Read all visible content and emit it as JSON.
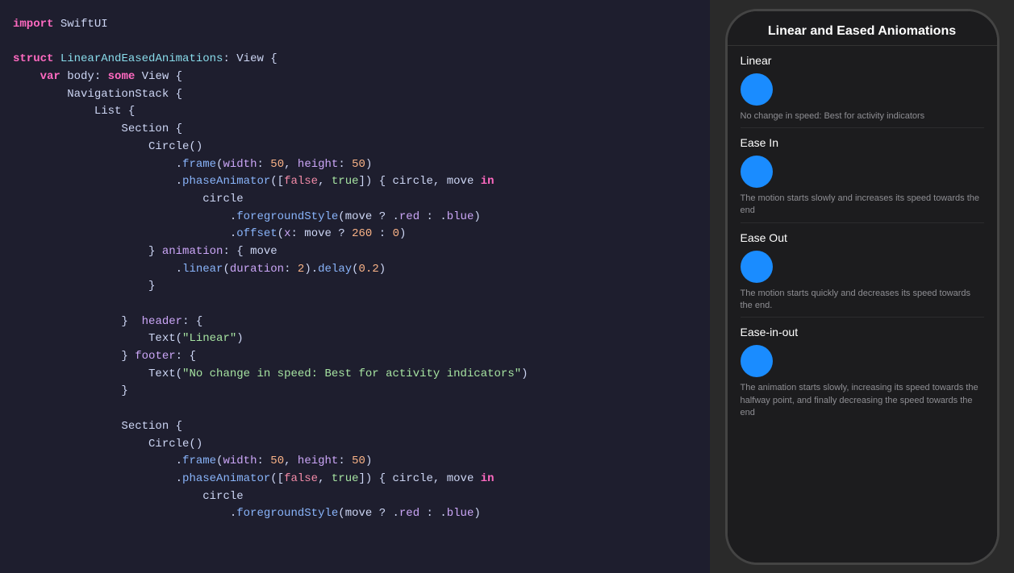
{
  "code_editor": {
    "lines": [
      {
        "tokens": [
          {
            "t": "kw-import",
            "v": "import"
          },
          {
            "t": "plain",
            "v": " SwiftUI"
          }
        ]
      },
      {
        "tokens": []
      },
      {
        "tokens": [
          {
            "t": "kw-struct",
            "v": "struct"
          },
          {
            "t": "plain",
            "v": " "
          },
          {
            "t": "type-name",
            "v": "LinearAndEasedAnimations"
          },
          {
            "t": "plain",
            "v": ": View {"
          }
        ]
      },
      {
        "tokens": [
          {
            "t": "plain",
            "v": "    "
          },
          {
            "t": "kw-var",
            "v": "var"
          },
          {
            "t": "plain",
            "v": " body: "
          },
          {
            "t": "kw-some",
            "v": "some"
          },
          {
            "t": "plain",
            "v": " View {"
          }
        ]
      },
      {
        "tokens": [
          {
            "t": "plain",
            "v": "        NavigationStack {"
          }
        ]
      },
      {
        "tokens": [
          {
            "t": "plain",
            "v": "            List {"
          }
        ]
      },
      {
        "tokens": [
          {
            "t": "plain",
            "v": "                Section {"
          }
        ]
      },
      {
        "tokens": [
          {
            "t": "plain",
            "v": "                    Circle()"
          }
        ]
      },
      {
        "tokens": [
          {
            "t": "plain",
            "v": "                        ."
          },
          {
            "t": "method",
            "v": "frame"
          },
          {
            "t": "plain",
            "v": "("
          },
          {
            "t": "prop",
            "v": "width"
          },
          {
            "t": "plain",
            "v": ": "
          },
          {
            "t": "num",
            "v": "50"
          },
          {
            "t": "plain",
            "v": ", "
          },
          {
            "t": "prop",
            "v": "height"
          },
          {
            "t": "plain",
            "v": ": "
          },
          {
            "t": "num",
            "v": "50"
          },
          {
            "t": "plain",
            "v": ")"
          }
        ]
      },
      {
        "tokens": [
          {
            "t": "plain",
            "v": "                        ."
          },
          {
            "t": "method",
            "v": "phaseAnimator"
          },
          {
            "t": "plain",
            "v": "(["
          },
          {
            "t": "bool-false",
            "v": "false"
          },
          {
            "t": "plain",
            "v": ", "
          },
          {
            "t": "bool-true",
            "v": "true"
          },
          {
            "t": "plain",
            "v": "]) { circle, "
          },
          {
            "t": "kw-move",
            "v": "move"
          },
          {
            "t": "plain",
            "v": " "
          },
          {
            "t": "kw-in",
            "v": "in"
          }
        ]
      },
      {
        "tokens": [
          {
            "t": "plain",
            "v": "                            circle"
          }
        ]
      },
      {
        "tokens": [
          {
            "t": "plain",
            "v": "                                ."
          },
          {
            "t": "method",
            "v": "foregroundStyle"
          },
          {
            "t": "plain",
            "v": "("
          },
          {
            "t": "kw-move",
            "v": "move"
          },
          {
            "t": "plain",
            "v": " ? ."
          },
          {
            "t": "prop",
            "v": "red"
          },
          {
            "t": "plain",
            "v": " : ."
          },
          {
            "t": "prop",
            "v": "blue"
          },
          {
            "t": "plain",
            "v": ")"
          }
        ]
      },
      {
        "tokens": [
          {
            "t": "plain",
            "v": "                                ."
          },
          {
            "t": "method",
            "v": "offset"
          },
          {
            "t": "plain",
            "v": "("
          },
          {
            "t": "prop",
            "v": "x"
          },
          {
            "t": "plain",
            "v": ": "
          },
          {
            "t": "kw-move",
            "v": "move"
          },
          {
            "t": "plain",
            "v": " ? "
          },
          {
            "t": "num",
            "v": "260"
          },
          {
            "t": "plain",
            "v": " : "
          },
          {
            "t": "num",
            "v": "0"
          },
          {
            "t": "plain",
            "v": ")"
          }
        ]
      },
      {
        "tokens": [
          {
            "t": "plain",
            "v": "                    } "
          },
          {
            "t": "prop",
            "v": "animation"
          },
          {
            "t": "plain",
            "v": ": { "
          },
          {
            "t": "kw-move",
            "v": "move"
          },
          {
            "t": "plain",
            "v": " "
          },
          {
            "t": "kw-in"
          }
        ]
      },
      {
        "tokens": [
          {
            "t": "plain",
            "v": "                        ."
          },
          {
            "t": "method",
            "v": "linear"
          },
          {
            "t": "plain",
            "v": "("
          },
          {
            "t": "prop",
            "v": "duration"
          },
          {
            "t": "plain",
            "v": ": "
          },
          {
            "t": "num",
            "v": "2"
          },
          {
            "t": "plain",
            "v": ")."
          },
          {
            "t": "method",
            "v": "delay"
          },
          {
            "t": "plain",
            "v": "("
          },
          {
            "t": "num",
            "v": "0.2"
          },
          {
            "t": "plain",
            "v": ")"
          }
        ]
      },
      {
        "tokens": [
          {
            "t": "plain",
            "v": "                    }"
          }
        ]
      },
      {
        "tokens": []
      },
      {
        "tokens": [
          {
            "t": "plain",
            "v": "                }  "
          },
          {
            "t": "prop",
            "v": "header"
          },
          {
            "t": "plain",
            "v": ": {"
          }
        ]
      },
      {
        "tokens": [
          {
            "t": "plain",
            "v": "                    Text("
          },
          {
            "t": "str",
            "v": "\"Linear\""
          },
          {
            "t": "plain",
            "v": ")"
          }
        ]
      },
      {
        "tokens": [
          {
            "t": "plain",
            "v": "                } "
          },
          {
            "t": "prop",
            "v": "footer"
          },
          {
            "t": "plain",
            "v": ": {"
          }
        ]
      },
      {
        "tokens": [
          {
            "t": "plain",
            "v": "                    Text("
          },
          {
            "t": "str",
            "v": "\"No change in speed: Best for activity indicators\""
          },
          {
            "t": "plain",
            "v": ")"
          }
        ]
      },
      {
        "tokens": [
          {
            "t": "plain",
            "v": "                }"
          }
        ]
      },
      {
        "tokens": []
      },
      {
        "tokens": [
          {
            "t": "plain",
            "v": "                Section {"
          }
        ]
      },
      {
        "tokens": [
          {
            "t": "plain",
            "v": "                    Circle()"
          }
        ]
      },
      {
        "tokens": [
          {
            "t": "plain",
            "v": "                        ."
          },
          {
            "t": "method",
            "v": "frame"
          },
          {
            "t": "plain",
            "v": "("
          },
          {
            "t": "prop",
            "v": "width"
          },
          {
            "t": "plain",
            "v": ": "
          },
          {
            "t": "num",
            "v": "50"
          },
          {
            "t": "plain",
            "v": ", "
          },
          {
            "t": "prop",
            "v": "height"
          },
          {
            "t": "plain",
            "v": ": "
          },
          {
            "t": "num",
            "v": "50"
          },
          {
            "t": "plain",
            "v": ")"
          }
        ]
      },
      {
        "tokens": [
          {
            "t": "plain",
            "v": "                        ."
          },
          {
            "t": "method",
            "v": "phaseAnimator"
          },
          {
            "t": "plain",
            "v": "(["
          },
          {
            "t": "bool-false",
            "v": "false"
          },
          {
            "t": "plain",
            "v": ", "
          },
          {
            "t": "bool-true",
            "v": "true"
          },
          {
            "t": "plain",
            "v": "]) { circle, "
          },
          {
            "t": "kw-move",
            "v": "move"
          },
          {
            "t": "plain",
            "v": " "
          },
          {
            "t": "kw-in",
            "v": "in"
          }
        ]
      },
      {
        "tokens": [
          {
            "t": "plain",
            "v": "                            circle"
          }
        ]
      },
      {
        "tokens": [
          {
            "t": "plain",
            "v": "                                ."
          },
          {
            "t": "method",
            "v": "foregroundStyle"
          },
          {
            "t": "plain",
            "v": "("
          },
          {
            "t": "kw-move",
            "v": "move"
          },
          {
            "t": "plain",
            "v": " ? ."
          },
          {
            "t": "prop",
            "v": "red"
          },
          {
            "t": "plain",
            "v": " : ."
          },
          {
            "t": "prop",
            "v": "blue"
          },
          {
            "t": "plain",
            "v": ")"
          }
        ]
      }
    ]
  },
  "phone": {
    "title": "Linear and Eased Aniomations",
    "sections": [
      {
        "label": "Linear",
        "description": "No change in speed: Best for activity indicators"
      },
      {
        "label": "Ease In",
        "description": "The motion starts slowly and increases its speed towards the end"
      },
      {
        "label": "Ease Out",
        "description": "The motion starts quickly and decreases its speed towards the end."
      },
      {
        "label": "Ease-in-out",
        "description": "The animation starts slowly, increasing its speed towards the halfway point, and finally decreasing the speed towards the end"
      }
    ]
  }
}
